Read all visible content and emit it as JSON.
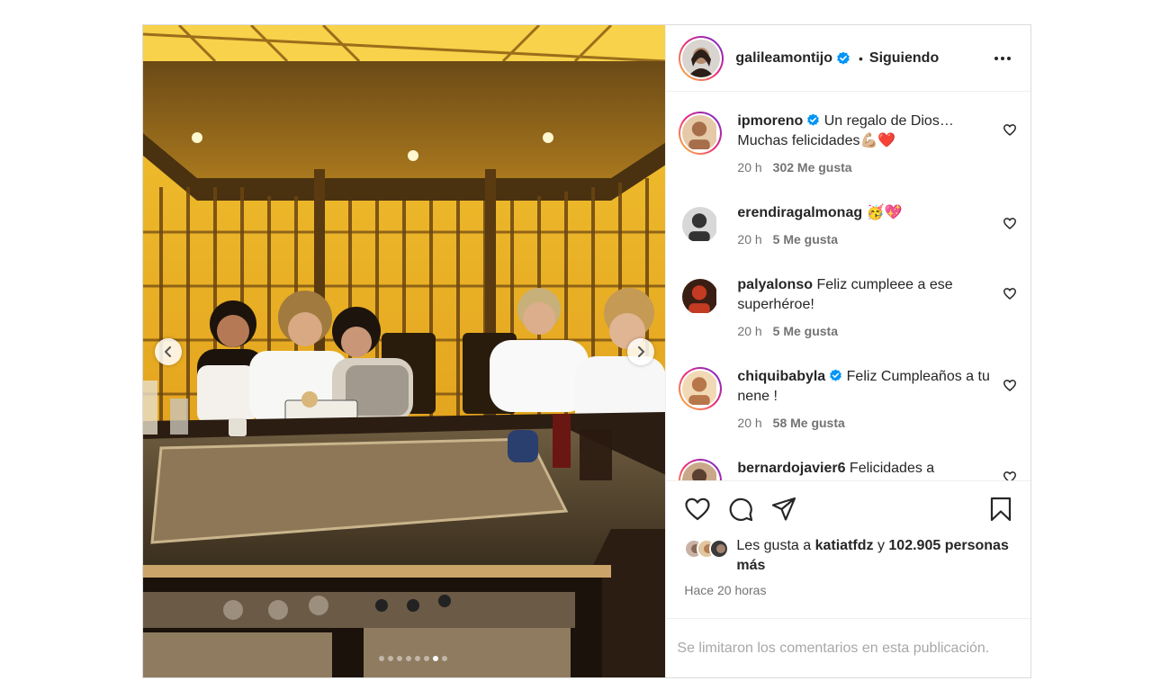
{
  "post": {
    "author": "galileamontijo",
    "author_verified": true,
    "separator": "•",
    "follow_label": "Siguiendo",
    "carousel": {
      "total": 8,
      "active_index": 6
    }
  },
  "comments": [
    {
      "user": "ipmoreno",
      "verified": true,
      "text": "Un regalo de Dios… Muchas felicidades💪🏼❤️",
      "time": "20 h",
      "likes": "302 Me gusta"
    },
    {
      "user": "erendiragalmonag",
      "verified": false,
      "text": "🥳💖",
      "time": "20 h",
      "likes": "5 Me gusta"
    },
    {
      "user": "palyalonso",
      "verified": false,
      "text": "Feliz cumpleee a ese superhéroe!",
      "time": "20 h",
      "likes": "5 Me gusta"
    },
    {
      "user": "chiquibabyla",
      "verified": true,
      "text": "Feliz Cumpleaños a tu nene !",
      "time": "20 h",
      "likes": "58 Me gusta"
    },
    {
      "user": "bernardojavier6",
      "verified": false,
      "text": "Felicidades a",
      "time": "",
      "likes": ""
    }
  ],
  "likes": {
    "prefix": "Les gusta a",
    "first_user": "katiatfdz",
    "conjunction": "y",
    "count": "102.905",
    "suffix": "personas más"
  },
  "timestamp": "Hace 20 horas",
  "comments_limited": "Se limitaron los comentarios en esta publicación.",
  "colors": {
    "verified": "#0095f6",
    "heart": "#ed4956",
    "muted": "#737373"
  }
}
